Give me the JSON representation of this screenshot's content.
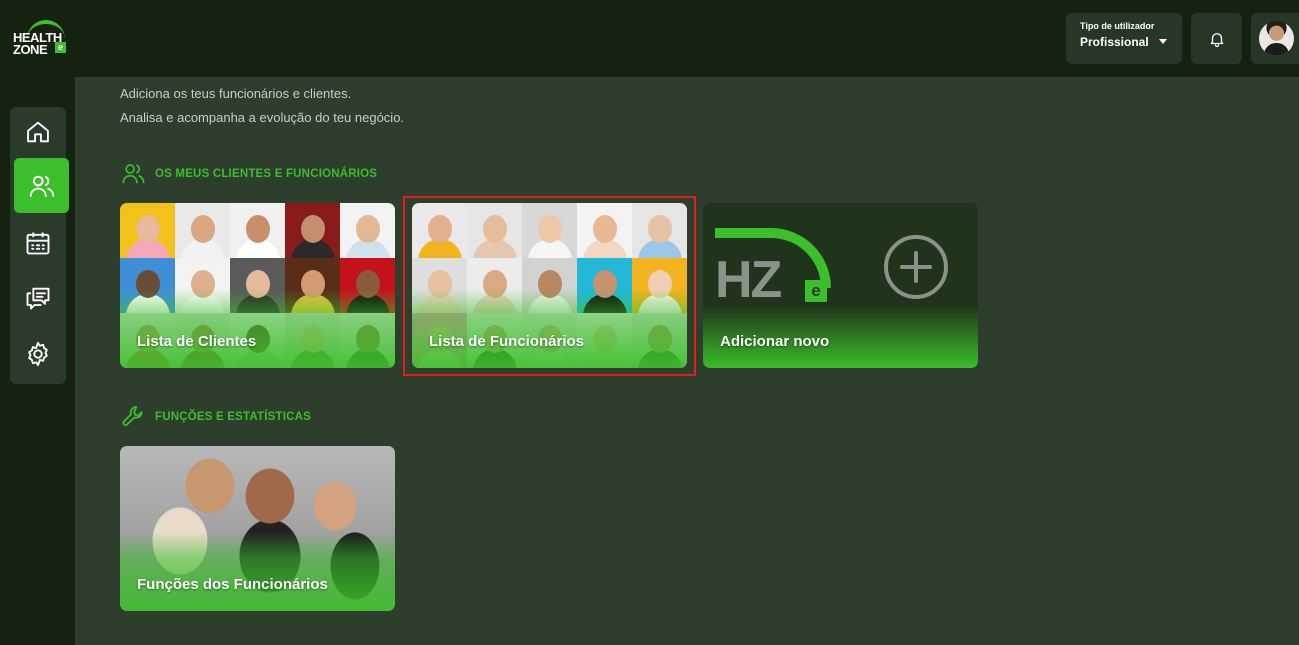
{
  "brand": {
    "line1": "HEALTH",
    "line2": "ZONE",
    "badge": "e"
  },
  "header": {
    "user_type_label": "Tipo de utilizador",
    "user_type_value": "Profissional"
  },
  "intro": {
    "line1": "Adiciona os teus funcionários e clientes.",
    "line2": "Analisa e acompanha a evolução do teu negócio."
  },
  "sidebar": {
    "items": [
      {
        "name": "home",
        "icon": "home-icon",
        "active": false
      },
      {
        "name": "users",
        "icon": "users-icon",
        "active": true
      },
      {
        "name": "calendar",
        "icon": "calendar-icon",
        "active": false
      },
      {
        "name": "messages",
        "icon": "chat-icon",
        "active": false
      },
      {
        "name": "settings",
        "icon": "gear-icon",
        "active": false
      }
    ]
  },
  "sections": {
    "clients_title": "OS MEUS CLIENTES E FUNCIONÁRIOS",
    "functions_title": "FUNÇÕES E ESTATÍSTICAS"
  },
  "cards": {
    "clients": "Lista de Clientes",
    "employees": "Lista de Funcionários",
    "add_new": "Adicionar novo",
    "add_logo_text": "HZ",
    "add_logo_badge": "e",
    "functions": "Funções dos Funcionários"
  },
  "colors": {
    "accent": "#3bbf2a",
    "bg": "#2d3e2d",
    "topbar": "#15220f",
    "highlight": "#e0201c"
  }
}
